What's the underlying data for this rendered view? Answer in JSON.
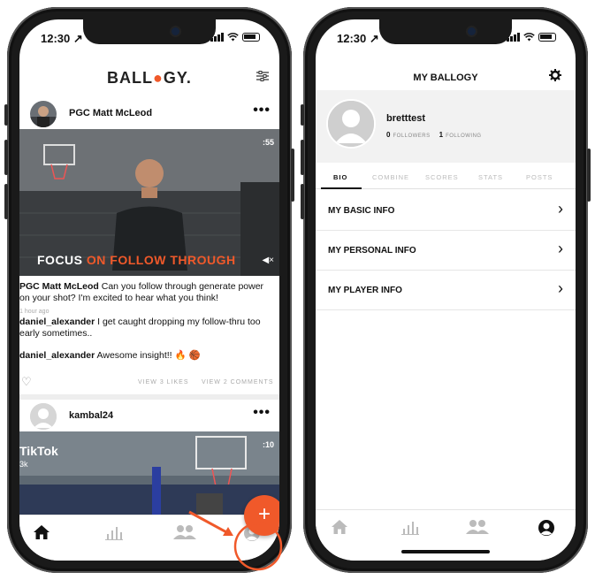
{
  "status": {
    "time": "12:30 ↗"
  },
  "left": {
    "brand": {
      "pre": "BALL",
      "ball": "●",
      "post": "GY."
    },
    "post1": {
      "user": "PGC Matt McLeod",
      "duration": ":55",
      "overlay_focus": "FOCUS ",
      "overlay_highlight": "ON FOLLOW THROUGH",
      "mute": "◀×",
      "caption_user": "PGC Matt McLeod",
      "caption_text": " Can you follow through generate power on your shot? I'm excited to hear what you think!",
      "time_ago": "1 hour ago",
      "comments": [
        {
          "user": "daniel_alexander",
          "text": " I get caught dropping my follow-thru too early sometimes.."
        },
        {
          "user": "daniel_alexander",
          "text": " Awesome insight!! 🔥 🏀"
        }
      ],
      "likes_label": "VIEW 3 LIKES",
      "comments_label": "VIEW 2 COMMENTS"
    },
    "post2": {
      "user": "kambal24",
      "duration": ":10",
      "overlay_brand": "TikTok",
      "overlay_sub": "3k"
    },
    "fab_label": "+"
  },
  "right": {
    "title": "MY BALLOGY",
    "username": "bretttest",
    "followers_count": "0",
    "followers_label": "FOLLOWERS",
    "following_count": "1",
    "following_label": "FOLLOWING",
    "tabs": [
      "BIO",
      "COMBINE",
      "SCORES",
      "STATS",
      "POSTS"
    ],
    "menu": [
      "MY BASIC INFO",
      "MY PERSONAL INFO",
      "MY PLAYER INFO"
    ],
    "chevron": "›"
  },
  "colors": {
    "accent": "#f0592a",
    "text": "#111111",
    "muted": "#aaaaaa"
  }
}
